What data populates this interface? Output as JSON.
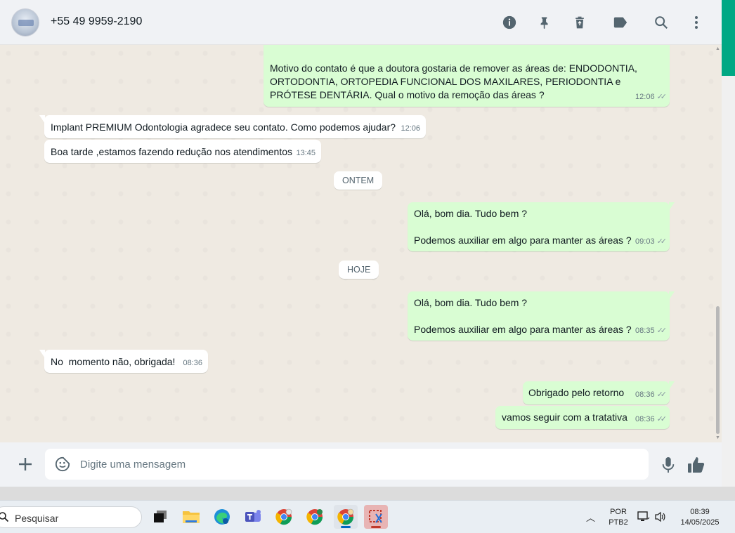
{
  "header": {
    "contact_name": "+55 49 9959-2190",
    "icons": [
      "info-icon",
      "pin-icon",
      "delete-icon",
      "label-icon",
      "search-icon",
      "more-vert-icon"
    ]
  },
  "messages": [
    {
      "dir": "out",
      "text": "Motivo do contato é que a doutora gostaria de remover as áreas de: ENDODONTIA, ORTODONTIA, ORTOPEDIA FUNCIONAL DOS MAXILARES, PERIODONTIA e PRÓTESE DENTÁRIA. Qual o motivo da remoção das áreas ?",
      "time": "12:06"
    },
    {
      "dir": "in",
      "text": "Implant PREMIUM Odontologia agradece seu contato. Como podemos ajudar?",
      "time": "12:06"
    },
    {
      "dir": "in",
      "text": "Boa tarde ,estamos fazendo redução nos atendimentos",
      "time": "13:45"
    },
    {
      "dir": "out",
      "text": "Olá, bom dia. Tudo bem ?\n\nPodemos auxiliar em algo para manter as áreas ?",
      "time": "09:03"
    },
    {
      "dir": "out",
      "text": "Olá, bom dia. Tudo bem ?\n\nPodemos auxiliar em algo para manter as áreas ?",
      "time": "08:35"
    },
    {
      "dir": "in",
      "text": "No  momento não, obrigada!",
      "time": "08:36"
    },
    {
      "dir": "out",
      "text": "Obrigado pelo retorno",
      "time": "08:36"
    },
    {
      "dir": "out",
      "text": "vamos seguir com a tratativa",
      "time": "08:36"
    }
  ],
  "date_chips": {
    "yesterday": "ONTEM",
    "today": "HOJE"
  },
  "composer": {
    "placeholder": "Digite uma mensagem"
  },
  "taskbar": {
    "search_label": "Pesquisar",
    "lang_top": "POR",
    "lang_bottom": "PTB2",
    "time": "08:39",
    "date": "14/05/2025"
  },
  "colors": {
    "outgoing": "#d9fdd3",
    "incoming": "#ffffff",
    "accent": "#00a884",
    "chat_bg": "#efeae2"
  }
}
